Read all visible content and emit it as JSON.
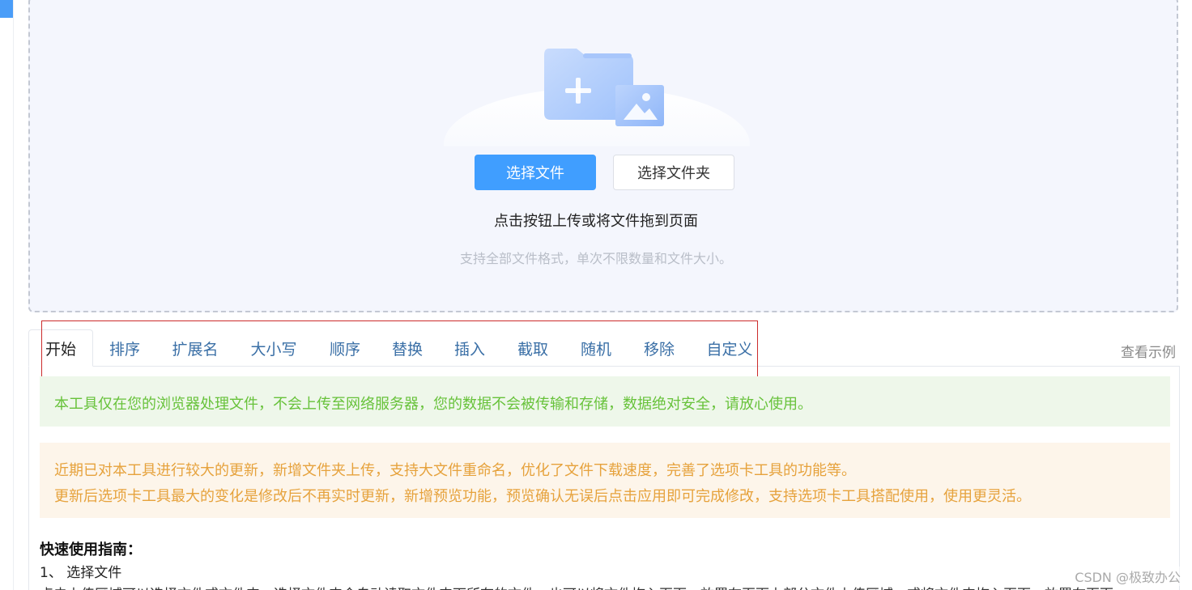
{
  "upload": {
    "select_file_label": "选择文件",
    "select_folder_label": "选择文件夹",
    "hint": "点击按钮上传或将文件拖到页面",
    "sub_hint": "支持全部文件格式，单次不限数量和文件大小。"
  },
  "tabs": [
    {
      "label": "开始",
      "active": true
    },
    {
      "label": "排序"
    },
    {
      "label": "扩展名"
    },
    {
      "label": "大小写"
    },
    {
      "label": "顺序"
    },
    {
      "label": "替换"
    },
    {
      "label": "插入"
    },
    {
      "label": "截取"
    },
    {
      "label": "随机"
    },
    {
      "label": "移除"
    },
    {
      "label": "自定义"
    }
  ],
  "view_example_label": "查看示例",
  "alerts": {
    "success": "本工具仅在您的浏览器处理文件，不会上传至网络服务器，您的数据不会被传输和存储，数据绝对安全，请放心使用。",
    "warning_line1": "近期已对本工具进行较大的更新，新增文件夹上传，支持大文件重命名，优化了文件下载速度，完善了选项卡工具的功能等。",
    "warning_line2": "更新后选项卡工具最大的变化是修改后不再实时更新，新增预览功能，预览确认无误后点击应用即可完成修改，支持选项卡工具搭配使用，使用更灵活。"
  },
  "guide": {
    "title": "快速使用指南：",
    "step1": "1、 选择文件",
    "step1_text": "点击上传区域可以选择文件或文件夹，选择文件夹会自动读取文件夹下所有的文件，也可以将文件拖入页面，放置在页面上部分文件上传区域，或将文件夹拖入页面，放置在页面"
  },
  "watermark": "CSDN @极致办公",
  "colors": {
    "primary": "#409eff",
    "tab_text": "#3a6fa6",
    "success_text": "#67c23a",
    "success_bg": "#eef7ea",
    "warning_text": "#e6a23c",
    "warning_bg": "#fdf5ea",
    "highlight_border": "#cc2b2b"
  },
  "icons": {
    "upload_illustration": "folder-add-image-icon"
  }
}
